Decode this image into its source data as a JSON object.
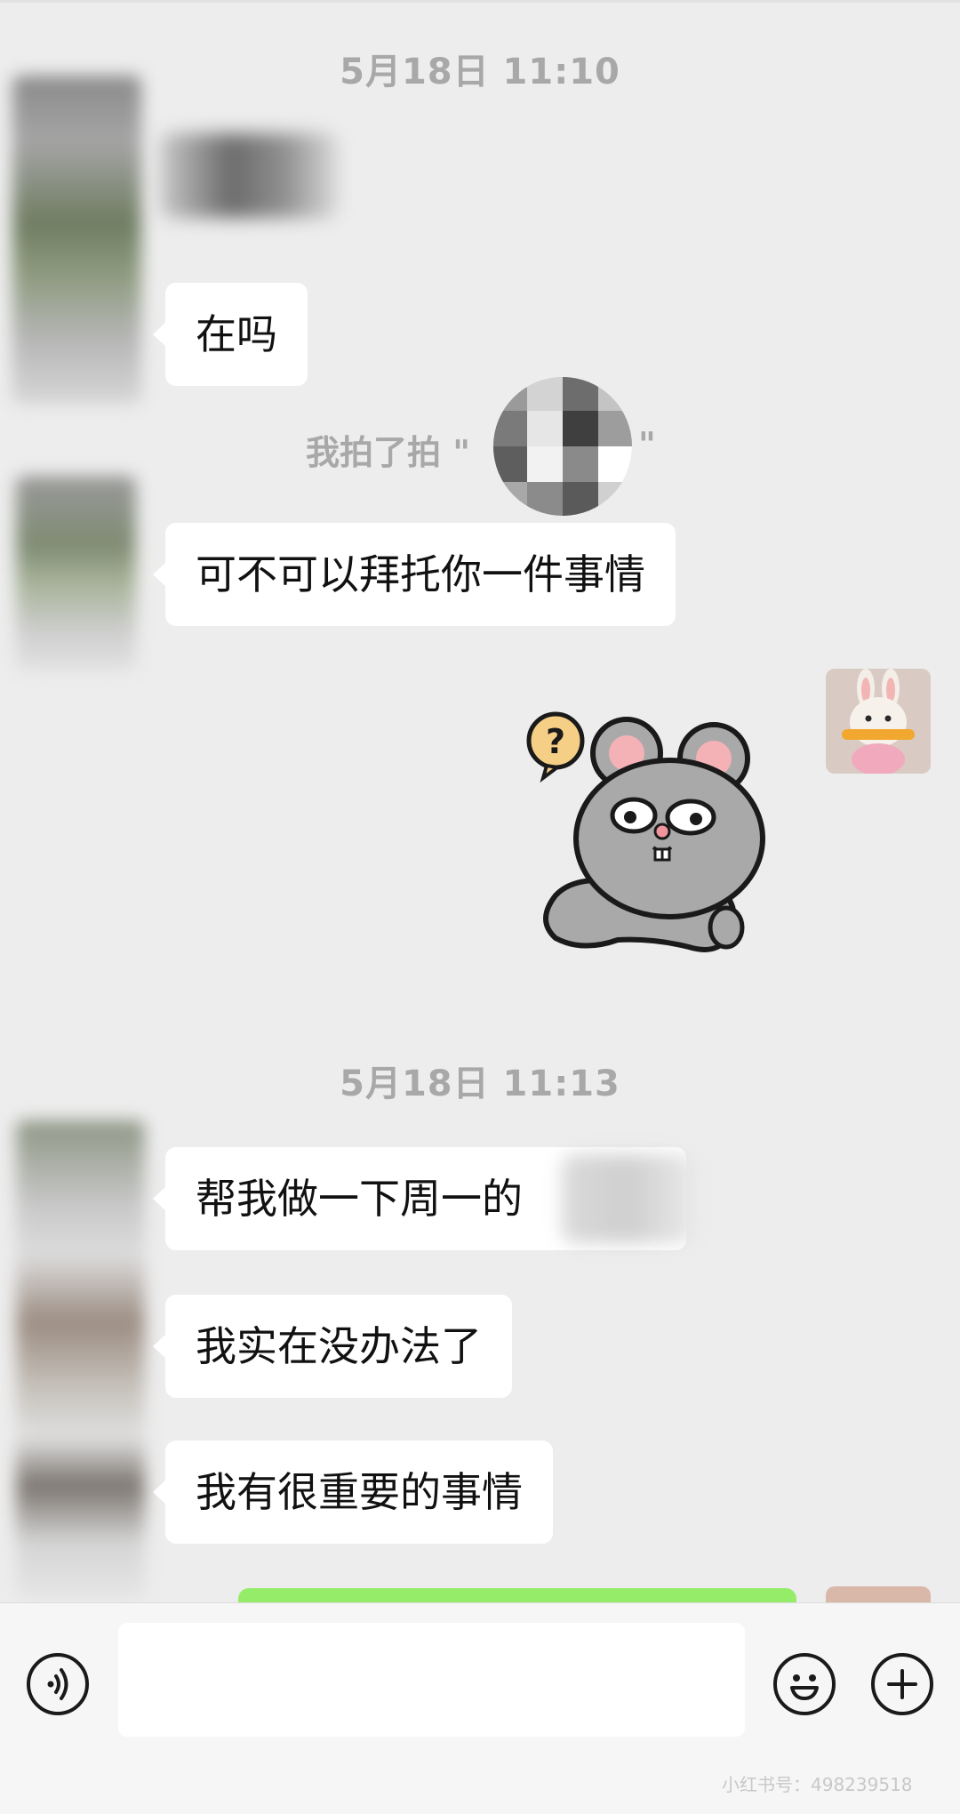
{
  "timestamps": [
    "5月18日 11:10",
    "5月18日 11:13"
  ],
  "messages": {
    "m1": "在吗",
    "pat_prefix": "我拍了拍 \"",
    "pat_suffix": "\"",
    "m2": "可不可以拜托你一件事情",
    "m3": "帮我做一下周一的",
    "m4": "我实在没办法了",
    "m5": "我有很重要的事情"
  },
  "sticker": {
    "name": "gray-mouse-question-sticker",
    "glyph": "?"
  },
  "input_bar": {
    "voice_icon": "voice-icon",
    "emoji_icon": "emoji-icon",
    "plus_icon": "plus-icon",
    "message_value": ""
  },
  "watermark": "小红书号：498239518",
  "colors": {
    "background": "#ededed",
    "bubble_incoming": "#ffffff",
    "bubble_outgoing": "#95ec69",
    "timestamp_text": "#a8a8a8"
  }
}
